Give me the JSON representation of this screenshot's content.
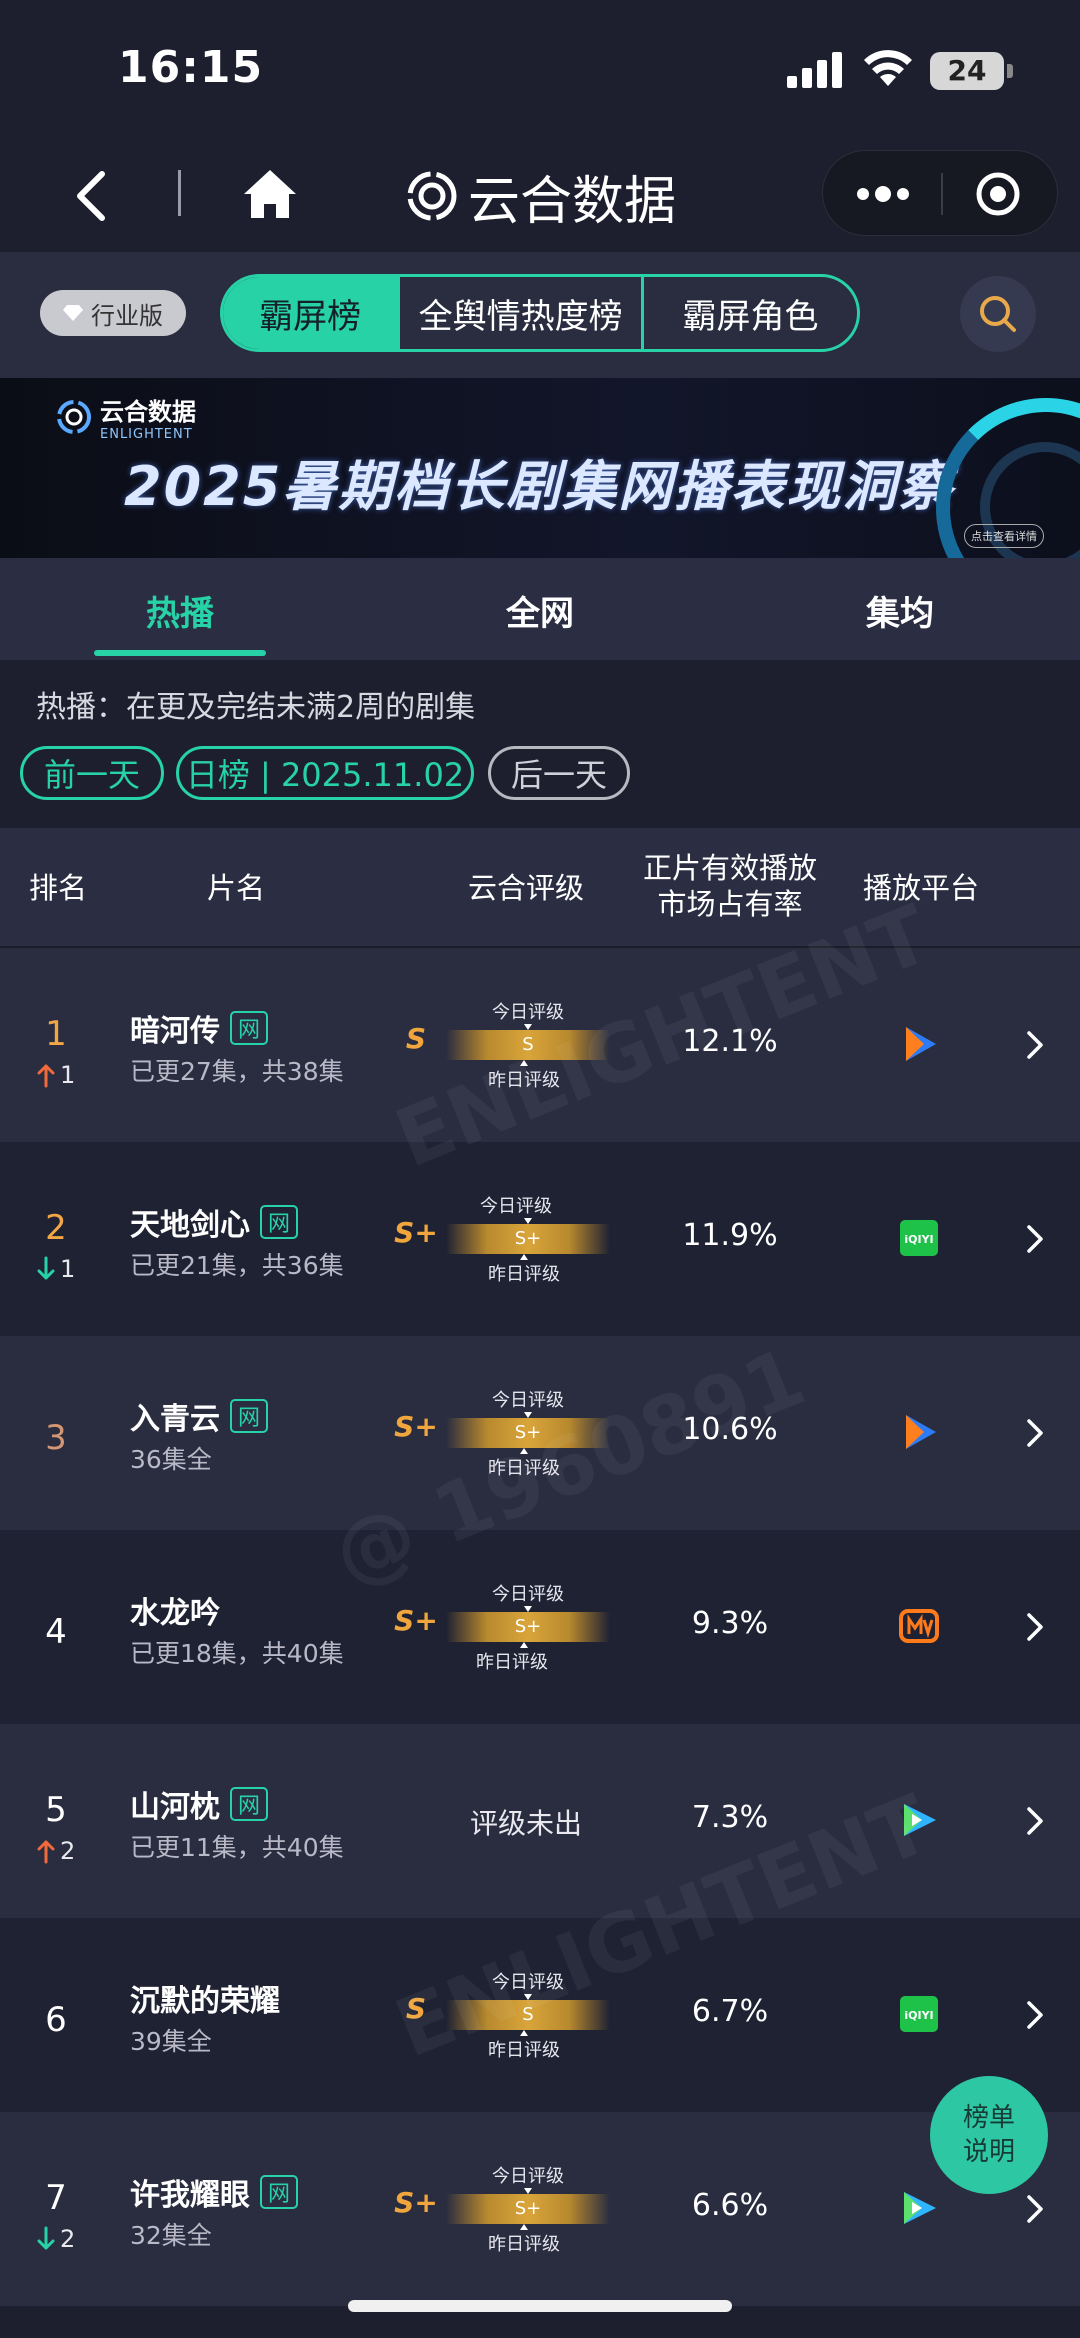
{
  "status_bar": {
    "time": "16:15",
    "battery": "24"
  },
  "nav": {
    "title": "云合数据"
  },
  "filter": {
    "industry_label": "行业版",
    "segments": [
      "霸屏榜",
      "全舆情热度榜",
      "霸屏角色"
    ],
    "active_segment": "霸屏榜"
  },
  "banner": {
    "logo_cn": "云合数据",
    "logo_en": "ENLIGHTENT",
    "title": "2025暑期档长剧集网播表现洞察",
    "button": "点击查看详情"
  },
  "tabs": [
    "热播",
    "全网",
    "集均"
  ],
  "info": {
    "description": "热播：在更及完结未满2周的剧集",
    "prev_day": "前一天",
    "date_pill": "日榜 | 2025.11.02",
    "next_day": "后一天"
  },
  "table_header": {
    "rank": "排名",
    "title": "片名",
    "rating": "云合评级",
    "share_line1": "正片有效播放",
    "share_line2": "市场占有率",
    "platform": "播放平台"
  },
  "rating_labels": {
    "today": "今日评级",
    "yesterday": "昨日评级",
    "none": "评级未出"
  },
  "net_badge": "网",
  "rows": [
    {
      "rank": "1",
      "change_dir": "up",
      "change": "1",
      "name": "暗河传",
      "net": true,
      "episodes": "已更27集，共38集",
      "rating": "S",
      "rating_bar": "S",
      "share": "12.1%",
      "platform": "tencent-video"
    },
    {
      "rank": "2",
      "change_dir": "down",
      "change": "1",
      "name": "天地剑心",
      "net": true,
      "episodes": "已更21集，共36集",
      "rating": "S+",
      "rating_bar": "S+",
      "share": "11.9%",
      "platform": "iqiyi"
    },
    {
      "rank": "3",
      "change_dir": "",
      "change": "",
      "name": "入青云",
      "net": true,
      "episodes": "36集全",
      "rating": "S+",
      "rating_bar": "S+",
      "share": "10.6%",
      "platform": "tencent-video"
    },
    {
      "rank": "4",
      "change_dir": "",
      "change": "",
      "name": "水龙吟",
      "net": false,
      "episodes": "已更18集，共40集",
      "rating": "S+",
      "rating_bar": "S+",
      "share": "9.3%",
      "platform": "mango-tv"
    },
    {
      "rank": "5",
      "change_dir": "up",
      "change": "2",
      "name": "山河枕",
      "net": true,
      "episodes": "已更11集，共40集",
      "rating": "",
      "rating_bar": "",
      "share": "7.3%",
      "platform": "youku"
    },
    {
      "rank": "6",
      "change_dir": "",
      "change": "",
      "name": "沉默的荣耀",
      "net": false,
      "episodes": "39集全",
      "rating": "S",
      "rating_bar": "S",
      "share": "6.7%",
      "platform": "iqiyi"
    },
    {
      "rank": "7",
      "change_dir": "down",
      "change": "2",
      "name": "许我耀眼",
      "net": true,
      "episodes": "32集全",
      "rating": "S+",
      "rating_bar": "S+",
      "share": "6.6%",
      "platform": "youku"
    }
  ],
  "fab": {
    "line1": "榜单",
    "line2": "说明"
  },
  "colors": {
    "accent": "#27d2a7",
    "rank_gold": "#f3a744",
    "rating_gold": "#f0a63d",
    "up": "#f06a3a",
    "down": "#27d2a7"
  },
  "platform_icons": {
    "tencent-video": "tencent-video-icon",
    "iqiyi": "iqiyi-icon",
    "mango-tv": "mango-tv-icon",
    "youku": "youku-icon"
  }
}
